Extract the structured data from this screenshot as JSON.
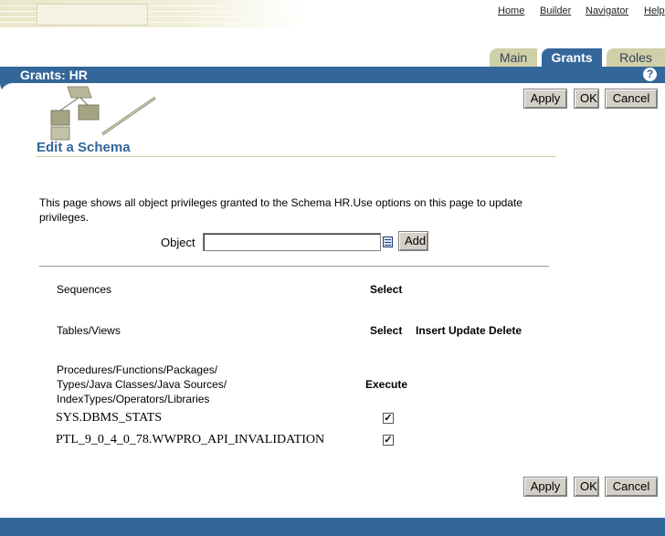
{
  "top_links": [
    "Home",
    "Builder",
    "Navigator",
    "Help"
  ],
  "tabs": {
    "main": "Main",
    "grants": "Grants",
    "roles": "Roles"
  },
  "header": {
    "title": "Grants: HR",
    "help": "?"
  },
  "buttons": {
    "apply": "Apply",
    "ok": "OK",
    "cancel": "Cancel",
    "add": "Add"
  },
  "page": {
    "heading": "Edit a Schema",
    "description": "This page shows all object privileges granted to the Schema HR.Use options on this page to update privileges.",
    "object_label": "Object",
    "object_value": ""
  },
  "privileges": {
    "sequences": {
      "label": "Sequences",
      "privs": "Select"
    },
    "tables": {
      "label": "Tables/Views",
      "select": "Select",
      "others": "Insert Update Delete"
    },
    "procedures": {
      "line1": "Procedures/Functions/Packages/",
      "line2": "Types/Java Classes/Java Sources/",
      "line3": "IndexTypes/Operators/Libraries",
      "privs": "Execute"
    }
  },
  "objects": [
    {
      "name": "SYS.DBMS_STATS",
      "execute": true
    },
    {
      "name": "PTL_9_0_4_0_78.WWPRO_API_INVALIDATION",
      "execute": true
    }
  ],
  "colors": {
    "brand_blue": "#336699",
    "tab_tan": "#cfcfa8"
  }
}
